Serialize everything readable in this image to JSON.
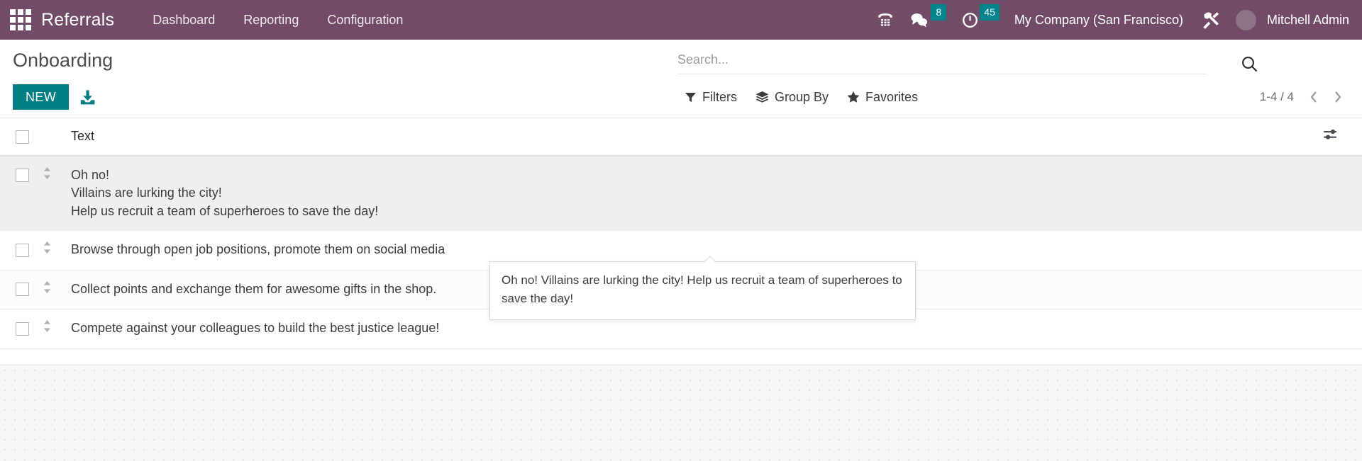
{
  "navbar": {
    "apps_icon": "apps-grid-icon",
    "brand": "Referrals",
    "menu": [
      {
        "label": "Dashboard"
      },
      {
        "label": "Reporting"
      },
      {
        "label": "Configuration"
      }
    ],
    "voip_icon": "phone-dialpad-icon",
    "messages_icon": "chat-bubbles-icon",
    "messages_count": "8",
    "activities_icon": "clock-icon",
    "activities_count": "45",
    "company": "My Company (San Francisco)",
    "tools_icon": "wrench-screwdriver-icon",
    "avatar": "user-avatar",
    "username": "Mitchell Admin",
    "accent_color": "#714B67",
    "badge_color": "#00848E"
  },
  "control_panel": {
    "title": "Onboarding",
    "new_button": "NEW",
    "import_icon": "import-download-icon",
    "new_button_color": "#017E84",
    "search": {
      "placeholder": "Search...",
      "value": "",
      "search_icon": "magnifier-icon"
    },
    "tools": [
      {
        "label": "Filters",
        "icon": "funnel-icon"
      },
      {
        "label": "Group By",
        "icon": "layers-icon"
      },
      {
        "label": "Favorites",
        "icon": "star-icon"
      }
    ],
    "pager": {
      "range": "1-4 / 4",
      "prev_icon": "chevron-left-icon",
      "next_icon": "chevron-right-icon"
    }
  },
  "list": {
    "select_all_checkbox": "unchecked",
    "columns": [
      {
        "label": "Text"
      }
    ],
    "optional_columns_icon": "sliders-icon",
    "rows": [
      {
        "selected": true,
        "handle_icon": "drag-handle-icon",
        "lines": [
          "Oh no!",
          "Villains are lurking the city!",
          "Help us recruit a team of superheroes to save the day!"
        ]
      },
      {
        "selected": false,
        "handle_icon": "drag-handle-icon",
        "lines": [
          "Browse through open job positions, promote them on social media"
        ]
      },
      {
        "selected": false,
        "handle_icon": "drag-handle-icon",
        "lines": [
          "Collect points and exchange them for awesome gifts in the shop."
        ]
      },
      {
        "selected": false,
        "handle_icon": "drag-handle-icon",
        "lines": [
          "Compete against your colleagues to build the best justice league!"
        ]
      }
    ]
  },
  "tooltip": {
    "text": "Oh no! Villains are lurking the city! Help us recruit a team of superheroes to save the day!"
  }
}
